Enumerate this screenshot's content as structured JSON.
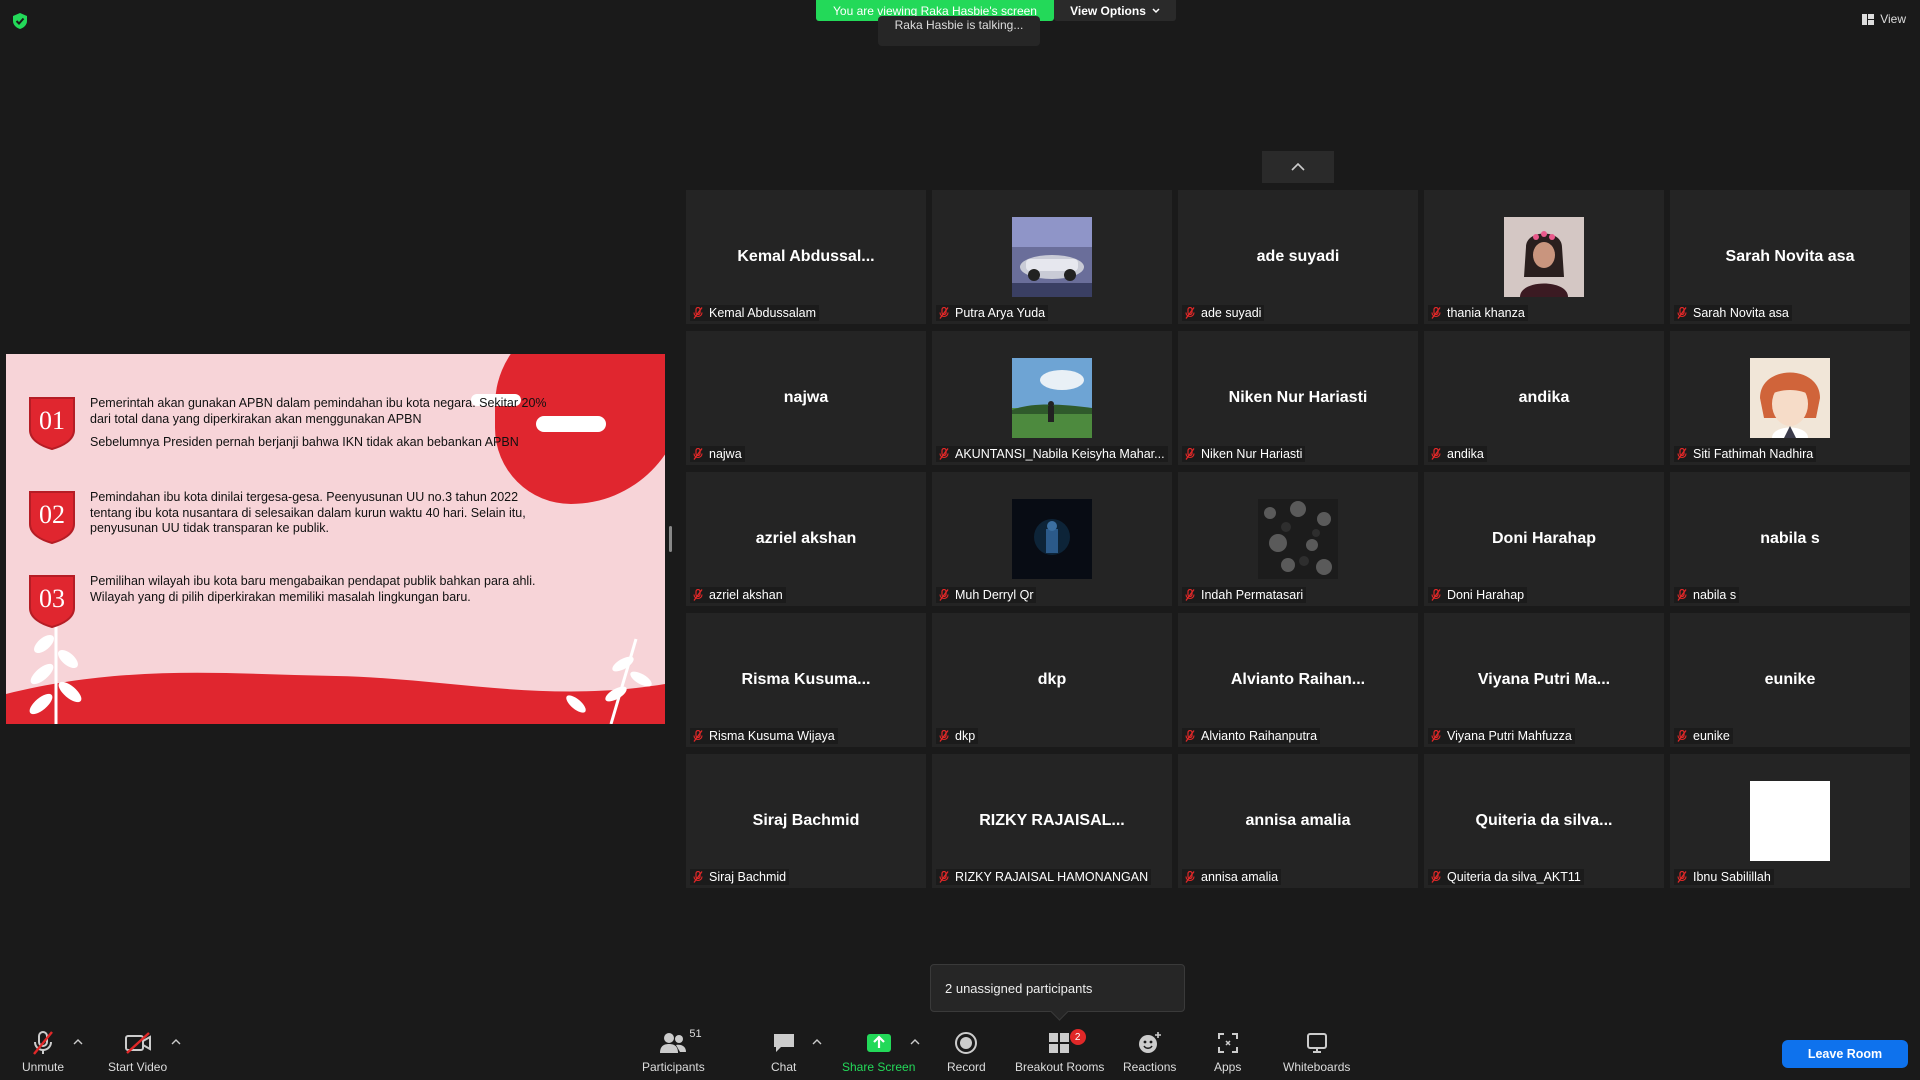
{
  "top": {
    "banner": "You are viewing Raka Hasbie's screen",
    "view_options": "View Options",
    "talking": "Raka Hasbie is talking...",
    "view": "View"
  },
  "slide": {
    "items": [
      {
        "num": "01",
        "lines": [
          "Pemerintah akan gunakan APBN dalam pemindahan ibu kota negara. Sekitar 20% dari total dana yang diperkirakan akan menggunakan APBN",
          "Sebelumnya Presiden pernah berjanji bahwa IKN tidak akan bebankan APBN"
        ]
      },
      {
        "num": "02",
        "lines": [
          "Pemindahan ibu kota dinilai tergesa-gesa. Peenyusunan UU no.3 tahun 2022 tentang ibu kota nusantara di selesaikan dalam kurun waktu 40 hari. Selain itu, penyusunan UU tidak transparan ke publik."
        ]
      },
      {
        "num": "03",
        "lines": [
          "Pemilihan wilayah ibu kota baru mengabaikan pendapat publik bahkan para ahli. Wilayah yang di pilih diperkirakan memiliki masalah lingkungan baru."
        ]
      }
    ],
    "accent": "#e0262f",
    "background": "#f7d4d8"
  },
  "participants": [
    {
      "big": "Kemal  Abdussal...",
      "label": "Kemal Abdussalam",
      "thumb": null
    },
    {
      "big": "",
      "label": "Putra Arya Yuda",
      "thumb": "car"
    },
    {
      "big": "ade suyadi",
      "label": "ade suyadi",
      "thumb": null
    },
    {
      "big": "",
      "label": "thania khanza",
      "thumb": "girl"
    },
    {
      "big": "Sarah Novita asa",
      "label": "Sarah Novita asa",
      "thumb": null
    },
    {
      "big": "najwa",
      "label": "najwa",
      "thumb": null
    },
    {
      "big": "",
      "label": "AKUNTANSI_Nabila Keisyha Mahar...",
      "thumb": "field"
    },
    {
      "big": "Niken Nur Hariasti",
      "label": "Niken Nur Hariasti",
      "thumb": null
    },
    {
      "big": "andika",
      "label": "andika",
      "thumb": null
    },
    {
      "big": "",
      "label": "Siti Fathimah Nadhira",
      "thumb": "anime"
    },
    {
      "big": "azriel akshan",
      "label": "azriel akshan",
      "thumb": null
    },
    {
      "big": "",
      "label": "Muh Derryl Qr",
      "thumb": "dark"
    },
    {
      "big": "",
      "label": "Indah Permatasari",
      "thumb": "texture"
    },
    {
      "big": "Doni Harahap",
      "label": "Doni Harahap",
      "thumb": null
    },
    {
      "big": "nabila s",
      "label": " nabila s",
      "thumb": null
    },
    {
      "big": "Risma  Kusuma...",
      "label": "Risma Kusuma Wijaya",
      "thumb": null
    },
    {
      "big": "dkp",
      "label": "dkp",
      "thumb": null
    },
    {
      "big": "Alvianto  Raihan...",
      "label": "Alvianto Raihanputra",
      "thumb": null
    },
    {
      "big": "Viyana Putri Ma...",
      "label": "Viyana Putri Mahfuzza",
      "thumb": null
    },
    {
      "big": "eunike",
      "label": "eunike",
      "thumb": null
    },
    {
      "big": "Siraj Bachmid",
      "label": "Siraj Bachmid",
      "thumb": null
    },
    {
      "big": "RIZKY  RAJAISAL...",
      "label": "RIZKY RAJAISAL HAMONANGAN",
      "thumb": null
    },
    {
      "big": "annisa amalia",
      "label": "annisa amalia",
      "thumb": null
    },
    {
      "big": "Quiteria da silva...",
      "label": "Quiteria da silva_AKT11",
      "thumb": null
    },
    {
      "big": "",
      "label": "Ibnu Sabilillah",
      "thumb": "white"
    }
  ],
  "popup": {
    "unassigned": "2 unassigned participants"
  },
  "toolbar": {
    "unmute": "Unmute",
    "start_video": "Start Video",
    "participants": "Participants",
    "participants_count": "51",
    "chat": "Chat",
    "share_screen": "Share Screen",
    "record": "Record",
    "breakout_rooms": "Breakout Rooms",
    "breakout_badge": "2",
    "reactions": "Reactions",
    "apps": "Apps",
    "whiteboards": "Whiteboards",
    "leave_room": "Leave Room"
  },
  "colors": {
    "green": "#23d959",
    "blue": "#0e72ed",
    "red": "#e02828"
  }
}
